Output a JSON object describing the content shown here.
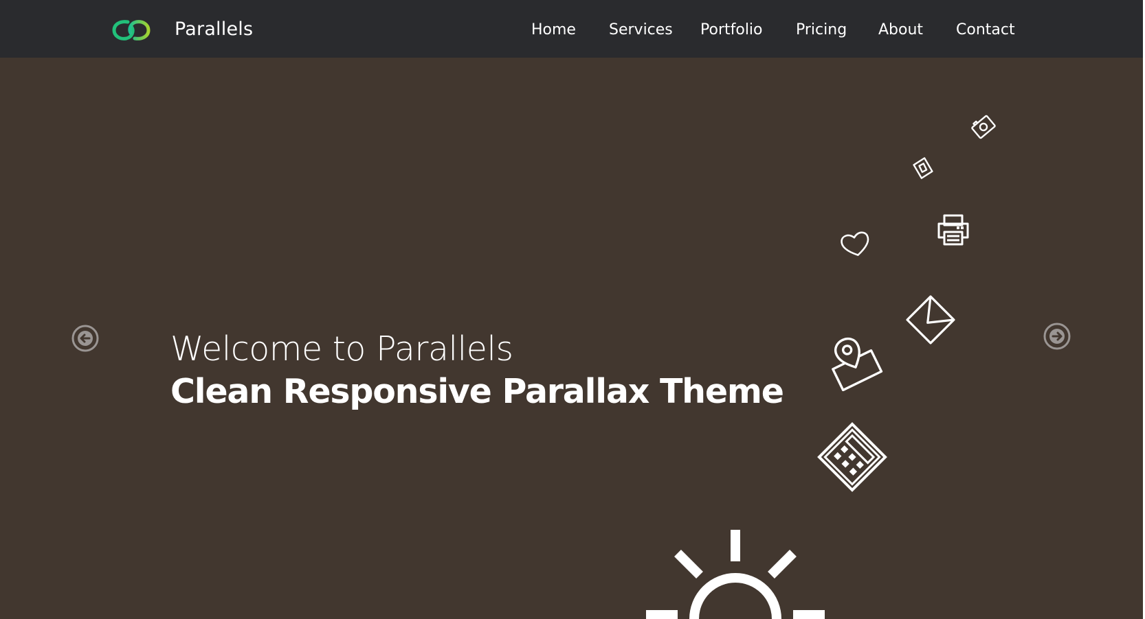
{
  "brand": {
    "name": "Parallels"
  },
  "nav": {
    "items": [
      "Home",
      "Services",
      "Portfolio",
      "Pricing",
      "About",
      "Contact"
    ]
  },
  "hero": {
    "welcome": "Welcome to Parallels",
    "tagline": "Clean Responsive Parallax Theme"
  },
  "colors": {
    "navbar_bg": "#2a2b2e",
    "hero_bg": "#42372f",
    "logo_green": "#2ecc71",
    "logo_lime": "#a4d330",
    "text": "#ffffff",
    "arrow": "#9a9593"
  },
  "icons": {
    "logo": "parallels-logo-icon",
    "prev": "arrow-left-circle-icon",
    "next": "arrow-right-circle-icon",
    "floating": [
      "camera-icon",
      "tag-icon",
      "printer-icon",
      "heart-icon",
      "envelope-icon",
      "location-pin-icon",
      "calculator-icon",
      "sun-icon"
    ]
  }
}
